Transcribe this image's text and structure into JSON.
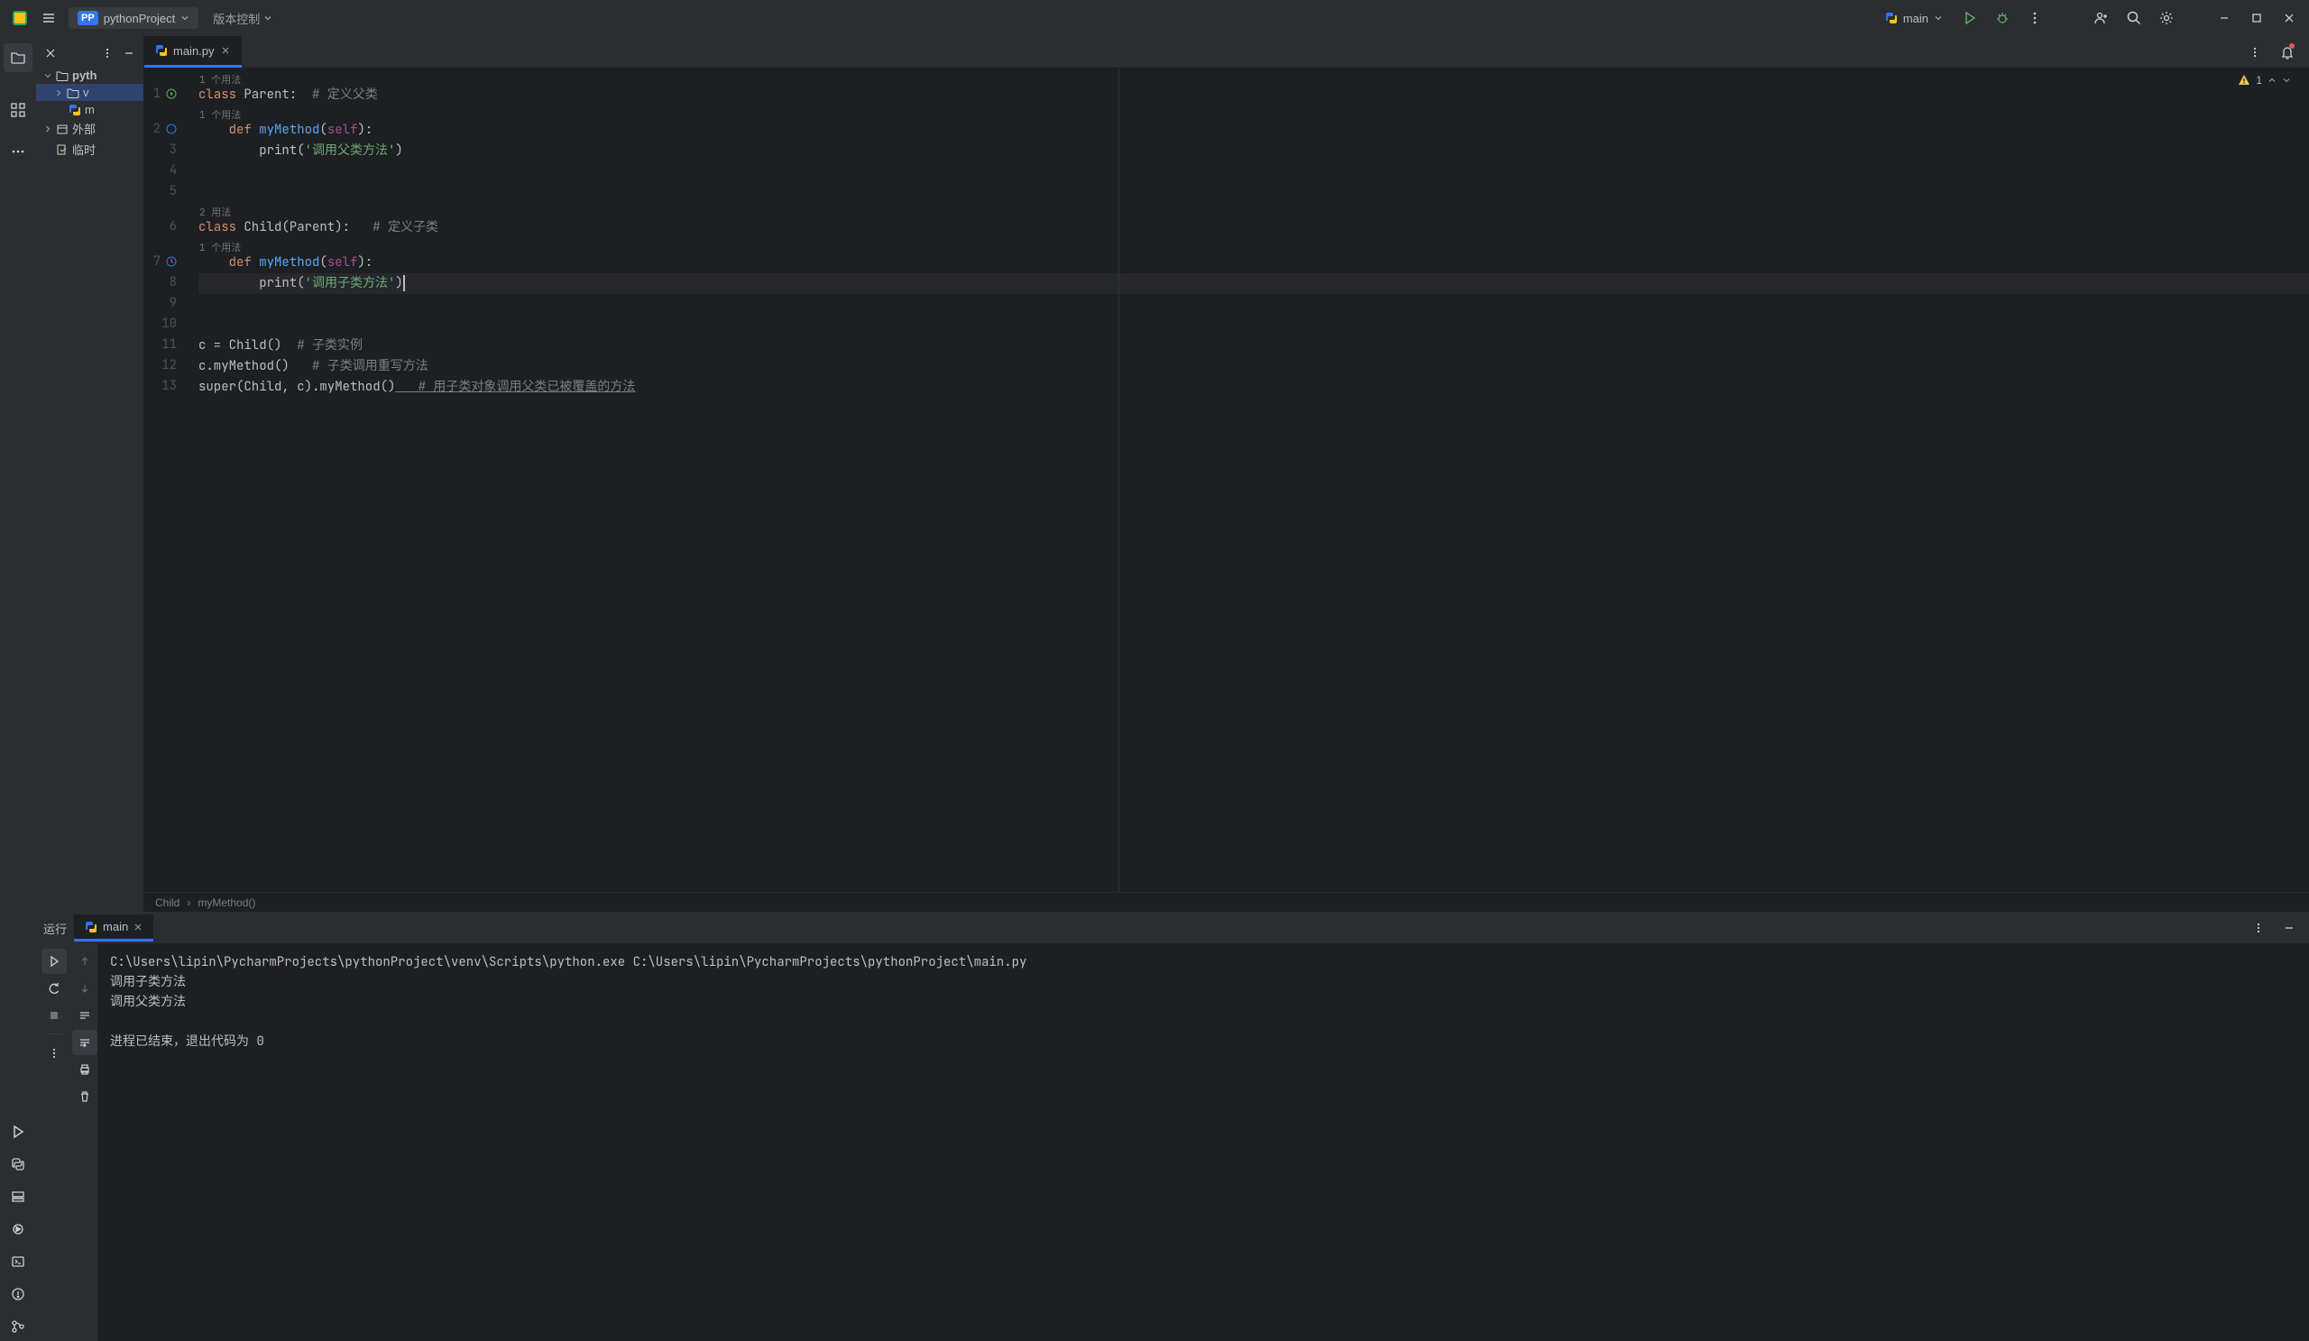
{
  "title": {
    "project_name": "pythonProject",
    "project_badge": "PP",
    "vcs_label": "版本控制",
    "run_config": "main"
  },
  "project_tree": {
    "root": "pyth",
    "venv": "v",
    "main_file": "m",
    "external": "外部",
    "scratch": "临时"
  },
  "tabs": {
    "main": "main.py"
  },
  "inspection": {
    "warn_count": "1"
  },
  "hints": {
    "usages_1": "1 个用法",
    "usages_2": "2 用法"
  },
  "code": {
    "l1_kw": "class",
    "l1_cls": " Parent:",
    "l1_comment": "  # 定义父类",
    "l2_kw": "def",
    "l2_fn": " myMethod",
    "l2_p1": "(",
    "l2_self": "self",
    "l2_p2": "):",
    "l3_fn": "print",
    "l3_p1": "(",
    "l3_str": "'调用父类方法'",
    "l3_p2": ")",
    "l6_kw": "class",
    "l6_cls": " Child(Parent):",
    "l6_comment": "   # 定义子类",
    "l7_kw": "def",
    "l7_fn": " myMethod",
    "l7_p1": "(",
    "l7_self": "self",
    "l7_p2": "):",
    "l8_fn": "print",
    "l8_p1": "(",
    "l8_str": "'调用子类方法'",
    "l8_p2": ")",
    "l11": "c = Child()",
    "l11_comment": "  # 子类实例",
    "l12": "c.myMethod()",
    "l12_comment": "   # 子类调用重写方法",
    "l13_kw": "super",
    "l13_rest": "(Child, c).myMethod()",
    "l13_comment": "   # 用子类对象调用父类已被覆盖的方法"
  },
  "line_numbers": [
    "1",
    "2",
    "3",
    "4",
    "5",
    "6",
    "7",
    "8",
    "9",
    "10",
    "11",
    "12",
    "13"
  ],
  "breadcrumb": {
    "class": "Child",
    "method": "myMethod()"
  },
  "run": {
    "label": "运行",
    "tab": "main"
  },
  "console": {
    "line1": "C:\\Users\\lipin\\PycharmProjects\\pythonProject\\venv\\Scripts\\python.exe C:\\Users\\lipin\\PycharmProjects\\pythonProject\\main.py",
    "line2": "调用子类方法",
    "line3": "调用父类方法",
    "line4": "进程已结束，退出代码为 0"
  }
}
